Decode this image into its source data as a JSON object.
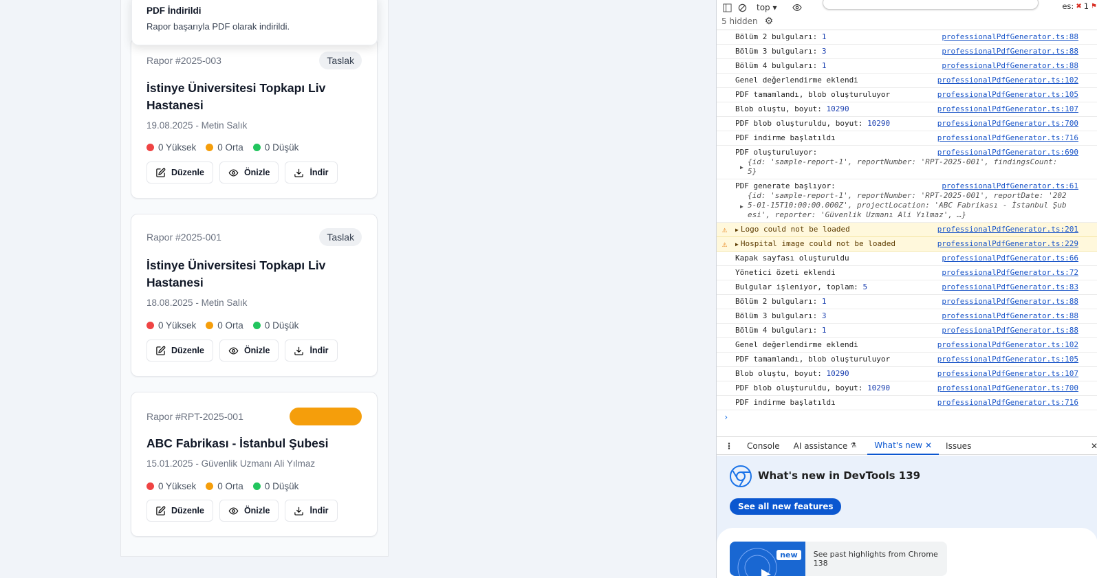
{
  "toast": {
    "title": "PDF İndirildi",
    "description": "Rapor başarıyla PDF olarak indirildi."
  },
  "cards": [
    {
      "number": "Rapor #2025-003",
      "badge": "Taslak",
      "title": "İstinye Üniversitesi Topkapı Liv Hastanesi",
      "meta": "19.08.2025 - Metin Salık"
    },
    {
      "number": "Rapor #2025-001",
      "badge": "Taslak",
      "title": "İstinye Üniversitesi Topkapı Liv Hastanesi",
      "meta": "18.08.2025 - Metin Salık"
    },
    {
      "number": "Rapor #RPT-2025-001",
      "badge": "",
      "title": "ABC Fabrikası - İstanbul Şubesi",
      "meta": "15.01.2025 - Güvenlik Uzmanı Ali Yılmaz"
    }
  ],
  "severity": {
    "high": "0 Yüksek",
    "medium": "0 Orta",
    "low": "0 Düşük"
  },
  "actions": {
    "edit": "Düzenle",
    "preview": "Önizle",
    "download": "İndir"
  },
  "colors": {
    "high": "#ef4444",
    "medium": "#f59e0b",
    "low": "#22c55e",
    "accent": "#0b57d0"
  },
  "devtools": {
    "context": "top",
    "hidden": "5 hidden",
    "issues_label": "es:",
    "issues_count": "1",
    "logs": [
      {
        "text": "Bölüm 2 bulguları: ",
        "num": "1",
        "src": "professionalPdfGenerator.ts:88"
      },
      {
        "text": "Bölüm 3 bulguları: ",
        "num": "3",
        "src": "professionalPdfGenerator.ts:88"
      },
      {
        "text": "Bölüm 4 bulguları: ",
        "num": "1",
        "src": "professionalPdfGenerator.ts:88"
      },
      {
        "text": "Genel değerlendirme eklendi",
        "num": "",
        "src": "professionalPdfGenerator.ts:102"
      },
      {
        "text": "PDF tamamlandı, blob oluşturuluyor",
        "num": "",
        "src": "professionalPdfGenerator.ts:105"
      },
      {
        "text": "Blob oluştu, boyut: ",
        "num": "10290",
        "src": "professionalPdfGenerator.ts:107"
      },
      {
        "text": "PDF blob oluşturuldu, boyut: ",
        "num": "10290",
        "src": "professionalPdfGenerator.ts:700"
      },
      {
        "text": "PDF indirme başlatıldı",
        "num": "",
        "src": "professionalPdfGenerator.ts:716"
      }
    ],
    "log_obj1": {
      "text": "PDF oluşturuluyor:",
      "src": "professionalPdfGenerator.ts:690",
      "line1": "{id: 'sample-report-1', reportNumber: 'RPT-2025-001', findingsCount:",
      "line2": "5}"
    },
    "log_obj2": {
      "text": "PDF generate başlıyor:",
      "src": "professionalPdfGenerator.ts:61",
      "line1": "{id: 'sample-report-1', reportNumber: 'RPT-2025-001', reportDate: '202",
      "line2": "5-01-15T10:00:00.000Z', projectLocation: 'ABC Fabrikası - İstanbul Şub",
      "line3": "esi', reporter: 'Güvenlik Uzmanı Ali Yılmaz', …}"
    },
    "warnings": [
      {
        "text": "Logo could not be loaded",
        "src": "professionalPdfGenerator.ts:201"
      },
      {
        "text": "Hospital image could not be loaded",
        "src": "professionalPdfGenerator.ts:229"
      }
    ],
    "logs2": [
      {
        "text": "Kapak sayfası oluşturuldu",
        "num": "",
        "src": "professionalPdfGenerator.ts:66"
      },
      {
        "text": "Yönetici özeti eklendi",
        "num": "",
        "src": "professionalPdfGenerator.ts:72"
      },
      {
        "text": "Bulgular işleniyor, toplam: ",
        "num": "5",
        "src": "professionalPdfGenerator.ts:83"
      },
      {
        "text": "Bölüm 2 bulguları: ",
        "num": "1",
        "src": "professionalPdfGenerator.ts:88"
      },
      {
        "text": "Bölüm 3 bulguları: ",
        "num": "3",
        "src": "professionalPdfGenerator.ts:88"
      },
      {
        "text": "Bölüm 4 bulguları: ",
        "num": "1",
        "src": "professionalPdfGenerator.ts:88"
      },
      {
        "text": "Genel değerlendirme eklendi",
        "num": "",
        "src": "professionalPdfGenerator.ts:102"
      },
      {
        "text": "PDF tamamlandı, blob oluşturuluyor",
        "num": "",
        "src": "professionalPdfGenerator.ts:105"
      },
      {
        "text": "Blob oluştu, boyut: ",
        "num": "10290",
        "src": "professionalPdfGenerator.ts:107"
      },
      {
        "text": "PDF blob oluşturuldu, boyut: ",
        "num": "10290",
        "src": "professionalPdfGenerator.ts:700"
      },
      {
        "text": "PDF indirme başlatıldı",
        "num": "",
        "src": "professionalPdfGenerator.ts:716"
      }
    ],
    "tabs": {
      "console": "Console",
      "ai": "AI assistance",
      "whats_new": "What's new",
      "issues": "Issues"
    },
    "whats_new": {
      "title": "What's new in DevTools 139",
      "button": "See all new features",
      "badge": "new",
      "highlight": "See past highlights from Chrome 138"
    }
  }
}
